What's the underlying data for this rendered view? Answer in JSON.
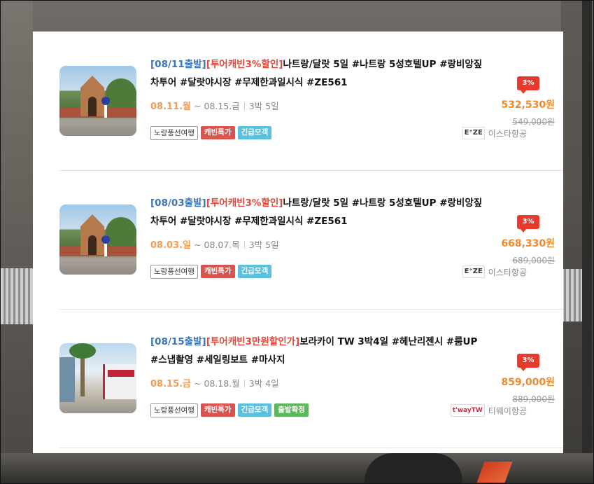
{
  "listings": [
    {
      "depart_tag": "[08/11출발]",
      "promo_tag": "[투어캐빈3%할인]",
      "title": "나트랑/달랏 5일 #나트랑 5성호텔UP #랑비앙짚차투어 #달랏야시장 #무제한과일시식 #ZE561",
      "date_start": "08.11.월",
      "date_end": "~ 08.15.금",
      "duration": "3박 5일",
      "tags": [
        {
          "label": "노랑풍선여행",
          "style": "outline"
        },
        {
          "label": "캐빈특가",
          "style": "red"
        },
        {
          "label": "긴급모객",
          "style": "blue"
        }
      ],
      "airline_logo": "E⁺ZE",
      "airline": "이스타항공",
      "discount": "3%",
      "price": "532,530원",
      "old_price": "549,000원",
      "thumb": "gate"
    },
    {
      "depart_tag": "[08/03출발]",
      "promo_tag": "[투어캐빈3%할인]",
      "title": "나트랑/달랏 5일 #나트랑 5성호텔UP #랑비앙짚차투어 #달랏야시장 #무제한과일시식 #ZE561",
      "date_start": "08.03.일",
      "date_end": "~ 08.07.목",
      "duration": "3박 5일",
      "tags": [
        {
          "label": "노랑풍선여행",
          "style": "outline"
        },
        {
          "label": "캐빈특가",
          "style": "red"
        },
        {
          "label": "긴급모객",
          "style": "blue"
        }
      ],
      "airline_logo": "E⁺ZE",
      "airline": "이스타항공",
      "discount": "3%",
      "price": "668,330원",
      "old_price": "689,000원",
      "thumb": "gate"
    },
    {
      "depart_tag": "[08/15출발]",
      "promo_tag": "[투어캐빈3만원할인가]",
      "title": "보라카이 TW 3박4일 #헤난리젠시 #룸UP #스냅촬영 #세일링보트 #마사지",
      "date_start": "08.15.금",
      "date_end": "~ 08.18.월",
      "duration": "3박 4일",
      "tags": [
        {
          "label": "노랑풍선여행",
          "style": "outline"
        },
        {
          "label": "캐빈특가",
          "style": "red"
        },
        {
          "label": "긴급모객",
          "style": "blue"
        },
        {
          "label": "출발확정",
          "style": "green"
        }
      ],
      "airline_logo": "t'wayTW",
      "airline": "티웨이항공",
      "discount": "3%",
      "price": "859,000원",
      "old_price": "889,000원",
      "thumb": "street"
    }
  ]
}
